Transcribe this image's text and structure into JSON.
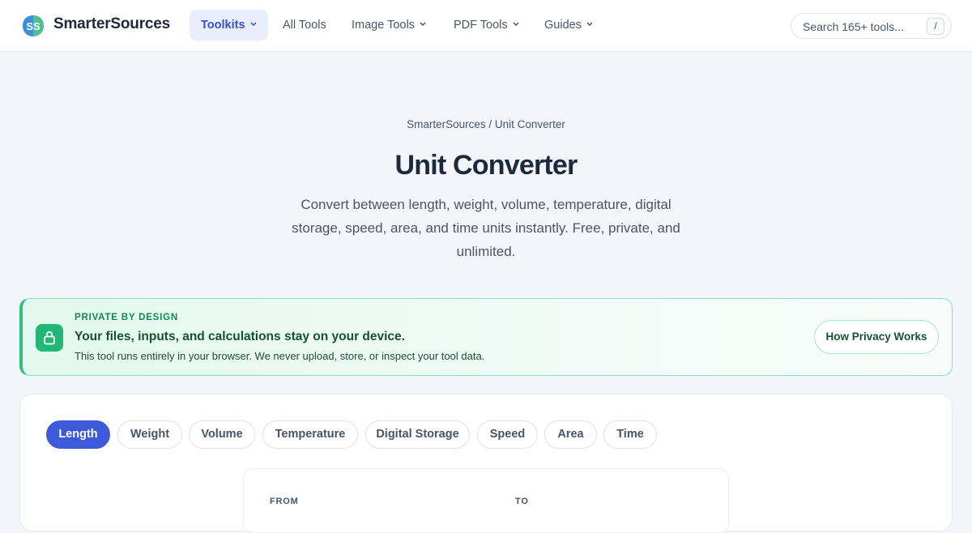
{
  "nav": {
    "brand": "SmarterSources",
    "items": [
      {
        "label": "Toolkits",
        "has_menu": true,
        "active": true
      },
      {
        "label": "All Tools",
        "has_menu": false,
        "active": false
      },
      {
        "label": "Image Tools",
        "has_menu": true,
        "active": false
      },
      {
        "label": "PDF Tools",
        "has_menu": true,
        "active": false
      },
      {
        "label": "Guides",
        "has_menu": true,
        "active": false
      }
    ],
    "search_placeholder": "Search 165+ tools...",
    "search_shortcut": "/"
  },
  "hero": {
    "breadcrumb": "SmarterSources / Unit Converter",
    "title": "Unit Converter",
    "subtitle": "Convert between length, weight, volume, temperature, digital storage, speed, area, and time units instantly. Free, private, and unlimited."
  },
  "privacy": {
    "eyebrow": "PRIVATE BY DESIGN",
    "headline": "Your files, inputs, and calculations stay on your device.",
    "description": "This tool runs entirely in your browser. We never upload, store, or inspect your tool data.",
    "button_label": "How Privacy Works",
    "icon": "lock-icon"
  },
  "converter": {
    "tabs": [
      {
        "label": "Length",
        "active": true
      },
      {
        "label": "Weight",
        "active": false
      },
      {
        "label": "Volume",
        "active": false
      },
      {
        "label": "Temperature",
        "active": false
      },
      {
        "label": "Digital Storage",
        "active": false
      },
      {
        "label": "Speed",
        "active": false
      },
      {
        "label": "Area",
        "active": false
      },
      {
        "label": "Time",
        "active": false
      }
    ],
    "from_label": "FROM",
    "to_label": "TO"
  },
  "colors": {
    "accent": "#3d5bd9",
    "privacy_green": "#20b874",
    "nav_active_bg": "#eaeefc"
  }
}
